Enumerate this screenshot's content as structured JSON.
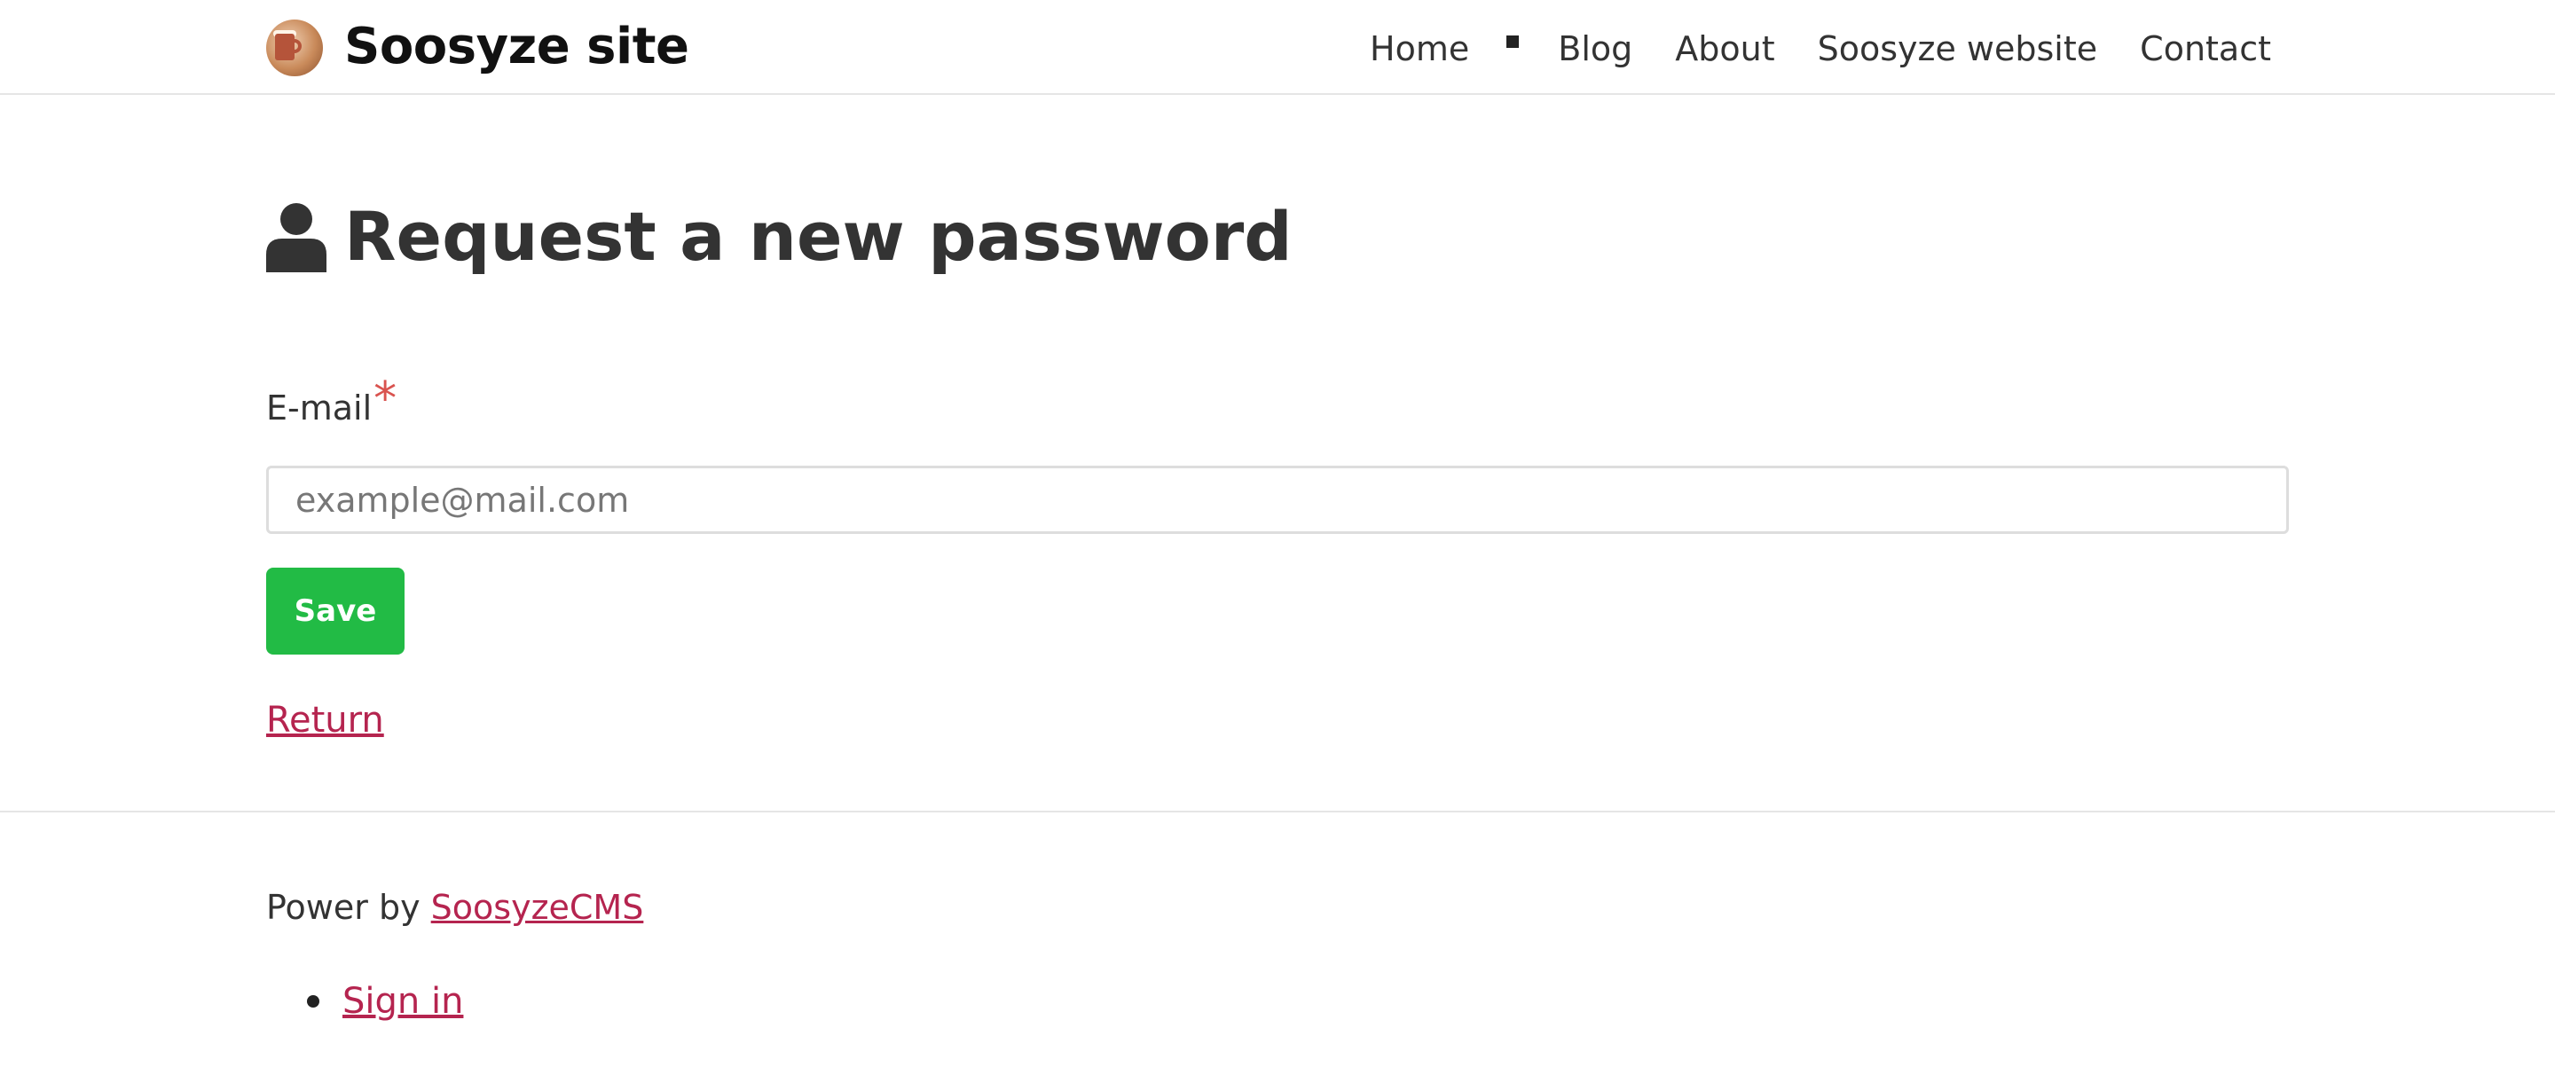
{
  "header": {
    "site_title": "Soosyze site",
    "nav": [
      {
        "label": "Home"
      },
      {
        "label": "Blog"
      },
      {
        "label": "About"
      },
      {
        "label": "Soosyze website"
      },
      {
        "label": "Contact"
      }
    ]
  },
  "main": {
    "page_title": "Request a new password",
    "title_icon": "user-icon",
    "email": {
      "label": "E-mail",
      "required_mark": "*",
      "placeholder": "example@mail.com",
      "value": ""
    },
    "save_label": "Save",
    "return_label": "Return"
  },
  "footer": {
    "power_by_text": "Power by ",
    "power_by_link": "SoosyzeCMS",
    "menu": [
      {
        "label": "Sign in"
      }
    ]
  },
  "colors": {
    "accent_link": "#b5244f",
    "save_button": "#22bb45",
    "required": "#d9534f"
  }
}
